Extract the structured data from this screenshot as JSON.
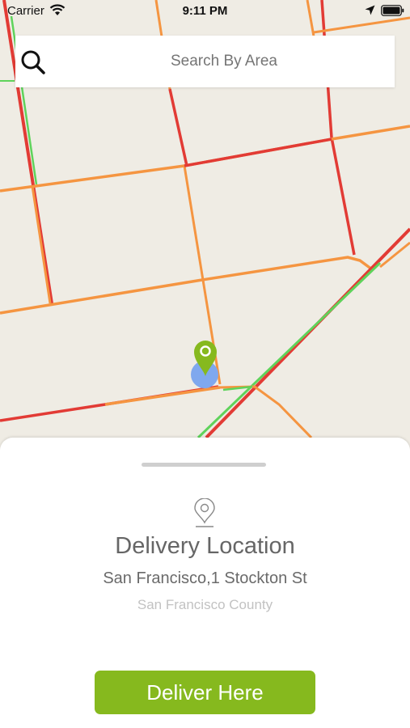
{
  "status_bar": {
    "carrier": "Carrier",
    "time": "9:11 PM"
  },
  "search": {
    "placeholder": "Search By Area"
  },
  "delivery_card": {
    "title": "Delivery Location",
    "address": "San Francisco,1 Stockton St",
    "county": "San Francisco County",
    "button_label": "Deliver Here"
  },
  "colors": {
    "map_background": "#efece4",
    "road_red": "#e23b35",
    "road_orange": "#f59541",
    "road_green": "#5fd35b",
    "pin_green": "#86b91e",
    "location_dot": "#7fa8ee",
    "button_green": "#86b91e"
  },
  "icons": {
    "wifi": "wifi-icon",
    "location_arrow": "location-arrow-icon",
    "battery": "battery-icon",
    "search": "search-icon",
    "map_pin": "map-pin-icon",
    "pin_outline": "location-pin-outline-icon"
  }
}
